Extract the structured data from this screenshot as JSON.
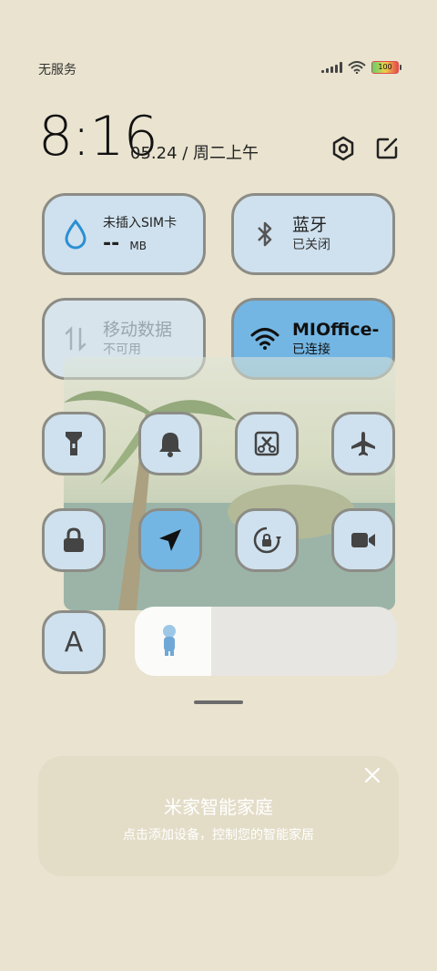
{
  "status": {
    "carrier": "无服务",
    "battery": "100"
  },
  "clock": {
    "time": "8:16",
    "date": "05.24 / 周二上午"
  },
  "tiles": {
    "data": {
      "title": "未插入SIM卡",
      "value": "--",
      "unit": "MB"
    },
    "bluetooth": {
      "title": "蓝牙",
      "sub": "已关闭"
    },
    "mobile": {
      "title": "移动数据",
      "sub": "不可用"
    },
    "wifi": {
      "title": "MIOffice-",
      "sub": "已连接"
    }
  },
  "toggles": [
    "flashlight-icon",
    "bell-icon",
    "screenshot-icon",
    "airplane-icon",
    "lock-icon",
    "location-icon",
    "rotation-lock-icon",
    "video-icon",
    "font-icon"
  ],
  "font_toggle_label": "A",
  "brightness": {
    "level": 0.29
  },
  "mijia": {
    "title": "米家智能家庭",
    "subtitle": "点击添加设备，控制您的智能家居"
  },
  "colors": {
    "accent": "#74b6e3",
    "tile": "#cfe1ee",
    "border": "#8c8c86",
    "background": "#e9e3cf"
  }
}
